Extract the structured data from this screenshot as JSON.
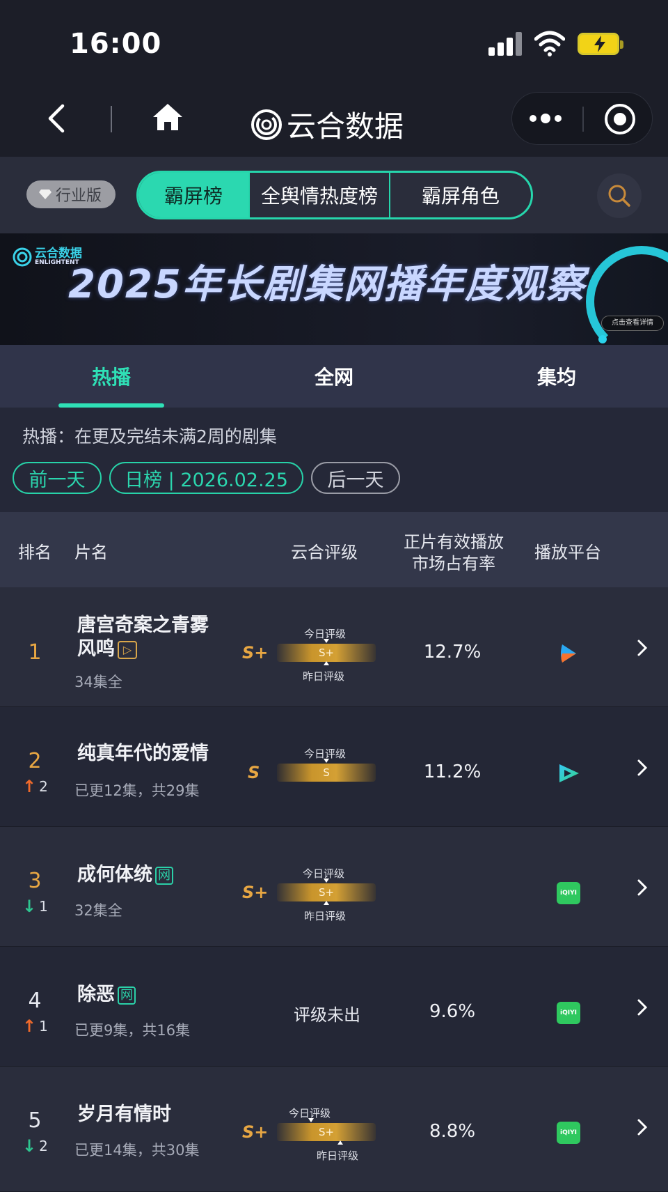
{
  "status_bar": {
    "time": "16:00"
  },
  "nav": {
    "app_title": "云合数据"
  },
  "toolbar": {
    "edition_label": "行业版",
    "segments": [
      "霸屏榜",
      "全舆情热度榜",
      "霸屏角色"
    ],
    "active_segment": "霸屏榜"
  },
  "banner": {
    "logo_cn": "云合数据",
    "logo_en": "ENLIGHTENT",
    "title": "2025年长剧集网播年度观察",
    "cta": "点击查看详情"
  },
  "tabs": [
    "热播",
    "全网",
    "集均"
  ],
  "active_tab": "热播",
  "info": {
    "note": "热播：在更及完结未满2周的剧集",
    "prev_day": "前一天",
    "date_label": "日榜 | 2026.02.25",
    "next_day": "后一天"
  },
  "table": {
    "headers": {
      "rank": "排名",
      "name": "片名",
      "grade": "云合评级",
      "share_line1": "正片有效播放",
      "share_line2": "市场占有率",
      "platform": "播放平台"
    },
    "grade_today_label": "今日评级",
    "grade_yesterday_label": "昨日评级",
    "rows": [
      {
        "rank": "1",
        "title_line1": "唐宫奇案之青雾",
        "title_line2": "风鸣",
        "tag": "▷",
        "sub": "34集全",
        "grade": "S+",
        "bar_grade": "S+",
        "share": "12.7%",
        "platform": "tencent-video-icon"
      },
      {
        "rank": "2",
        "delta": "2",
        "direction": "up",
        "title_line1": "纯真年代的爱情",
        "sub": "已更12集，共29集",
        "grade": "S",
        "bar_grade": "S",
        "share": "11.2%",
        "platform": "youku-icon"
      },
      {
        "rank": "3",
        "delta": "1",
        "direction": "down",
        "title_line1": "成何体统",
        "tag": "网",
        "sub": "32集全",
        "grade": "S+",
        "bar_grade": "S+",
        "share": "",
        "platform": "iqiyi-icon"
      },
      {
        "rank": "4",
        "delta": "1",
        "direction": "up",
        "title_line1": "除恶",
        "tag": "网",
        "sub": "已更9集，共16集",
        "pending_text": "评级未出",
        "share": "9.6%",
        "platform": "iqiyi-icon"
      },
      {
        "rank": "5",
        "delta": "2",
        "direction": "down",
        "title_line1": "岁月有情时",
        "sub": "已更14集，共30集",
        "grade": "S+",
        "bar_grade": "S+",
        "share": "8.8%",
        "platform": "iqiyi-icon"
      }
    ]
  },
  "platform_labels": {
    "iqiyi": "iQIYI"
  },
  "colors": {
    "accent": "#2bd8b0",
    "grade": "#e8a743",
    "up": "#f06a2b",
    "down": "#2ec48f",
    "rank1": "#e8a743"
  }
}
